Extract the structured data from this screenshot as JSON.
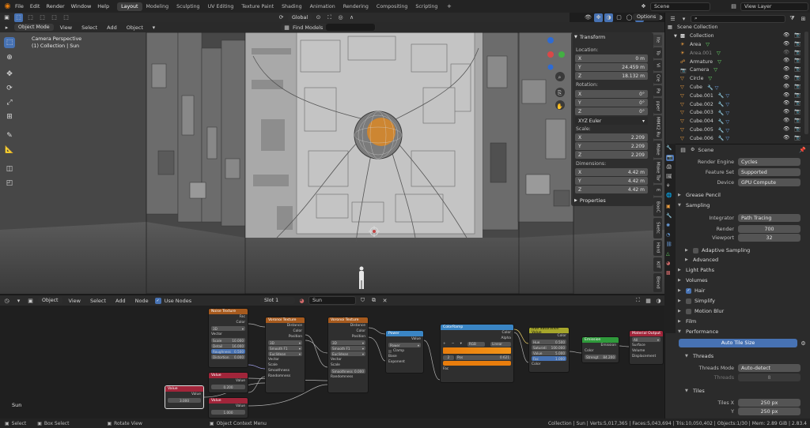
{
  "topbar": {
    "menus": [
      "File",
      "Edit",
      "Render",
      "Window",
      "Help"
    ],
    "workspaces": [
      "Layout",
      "Modeling",
      "Sculpting",
      "UV Editing",
      "Texture Paint",
      "Shading",
      "Animation",
      "Rendering",
      "Compositing",
      "Scripting"
    ],
    "active_workspace": "Layout",
    "scene": "Scene",
    "view_layer": "View Layer"
  },
  "viewport": {
    "mode": "Object Mode",
    "menus": [
      "View",
      "Select",
      "Add",
      "Object"
    ],
    "orientation": "Global",
    "options_label": "Options",
    "info_line1": "Camera Perspective",
    "info_line2": "(1) Collection | Sun",
    "find_models": "Find Models"
  },
  "npanel": {
    "transform_title": "Transform",
    "location_label": "Location:",
    "location": [
      {
        "axis": "X",
        "value": "0 m"
      },
      {
        "axis": "Y",
        "value": "24.459 m"
      },
      {
        "axis": "Z",
        "value": "18.132 m"
      }
    ],
    "rotation_label": "Rotation:",
    "rotation": [
      {
        "axis": "X",
        "value": "0°"
      },
      {
        "axis": "Y",
        "value": "0°"
      },
      {
        "axis": "Z",
        "value": "0°"
      }
    ],
    "rotation_mode": "XYZ Euler",
    "scale_label": "Scale:",
    "scale": [
      {
        "axis": "X",
        "value": "2.209"
      },
      {
        "axis": "Y",
        "value": "2.209"
      },
      {
        "axis": "Z",
        "value": "2.209"
      }
    ],
    "dimensions_label": "Dimensions:",
    "dimensions": [
      {
        "axis": "X",
        "value": "4.42 m"
      },
      {
        "axis": "Y",
        "value": "4.42 m"
      },
      {
        "axis": "Z",
        "value": "4.42 m"
      }
    ],
    "properties_title": "Properties",
    "side_tabs": [
      "Ite",
      "To",
      "Vi",
      "Cre",
      "Pa",
      "pper",
      "MMX2 Ru",
      "Make",
      "Make Tar",
      "E",
      "BooC",
      "Sketc",
      "Hard",
      "KIT",
      "Blend"
    ]
  },
  "outliner": {
    "search_placeholder": "",
    "root": "Scene Collection",
    "collection": "Collection",
    "items": [
      "Area",
      "Area.001",
      "Armature",
      "Camera",
      "Circle",
      "Cube",
      "Cube.001",
      "Cube.002",
      "Cube.003",
      "Cube.004",
      "Cube.005",
      "Cube.006"
    ]
  },
  "properties": {
    "scene_label": "Scene",
    "render_engine_label": "Render Engine",
    "render_engine": "Cycles",
    "feature_set_label": "Feature Set",
    "feature_set": "Supported",
    "device_label": "Device",
    "device": "GPU Compute",
    "grease_pencil": "Grease Pencil",
    "sampling": "Sampling",
    "integrator_label": "Integrator",
    "integrator": "Path Tracing",
    "render_label": "Render",
    "render_samples": "700",
    "viewport_label": "Viewport",
    "viewport_samples": "32",
    "adaptive_sampling": "Adaptive Sampling",
    "advanced": "Advanced",
    "light_paths": "Light Paths",
    "volumes": "Volumes",
    "hair": "Hair",
    "simplify": "Simplify",
    "motion_blur": "Motion Blur",
    "film": "Film",
    "performance": "Performance",
    "auto_tile_size": "Auto Tile Size",
    "threads": "Threads",
    "threads_mode_label": "Threads Mode",
    "threads_mode": "Auto-detect",
    "threads_label": "Threads",
    "threads_value": "8",
    "tiles": "Tiles",
    "tiles_x_label": "Tiles X",
    "tiles_x": "250 px",
    "tiles_y_label": "Y",
    "tiles_y": "250 px"
  },
  "node_editor": {
    "type": "Object",
    "menus": [
      "View",
      "Select",
      "Add",
      "Node"
    ],
    "use_nodes": "Use Nodes",
    "slot": "Slot 1",
    "material": "Sun",
    "frame_label": "Sun",
    "nodes": {
      "noise": {
        "title": "Noise Texture",
        "outputs": [
          "Fac",
          "Color"
        ],
        "dim": "3D",
        "inputs": [
          "Vector"
        ],
        "fields": [
          {
            "k": "Scale",
            "v": "10.000"
          },
          {
            "k": "Detail",
            "v": "16.000"
          },
          {
            "k": "Roughness",
            "v": "0.500"
          },
          {
            "k": "Distortion",
            "v": "0.000"
          }
        ]
      },
      "voronoi1": {
        "title": "Voronoi Texture",
        "outputs": [
          "Distance",
          "Color",
          "Position"
        ],
        "dim": "3D",
        "feature": "Smooth F1",
        "metric": "Euclidean",
        "inputs": [
          "Vector",
          "Scale",
          "Smoothness",
          "Randomness"
        ]
      },
      "voronoi2": {
        "title": "Voronoi Texture",
        "outputs": [
          "Distance",
          "Color",
          "Position"
        ],
        "dim": "3D",
        "feature": "Smooth F1",
        "metric": "Euclidean",
        "inputs": [
          "Vector",
          "Scale",
          "Smoothness",
          "Randomness"
        ],
        "smooth_value": "0.000"
      },
      "power": {
        "title": "Power",
        "output": "Value",
        "op": "Power",
        "clamp": "Clamp",
        "inputs": [
          "Base",
          "Exponent"
        ]
      },
      "colorramp": {
        "title": "ColorRamp",
        "outputs": [
          "Color",
          "Alpha"
        ],
        "mode": "RGB",
        "interp": "Linear",
        "stop": "2",
        "pos_label": "Pos",
        "pos": "0.621",
        "input": "Fac"
      },
      "hsv": {
        "title": "Hue Saturation Value",
        "output": "Color",
        "fields": [
          {
            "k": "Hue",
            "v": "0.500"
          },
          {
            "k": "Saturati",
            "v": "100.000"
          },
          {
            "k": "Value",
            "v": "5.000"
          },
          {
            "k": "Fac",
            "v": "1.000"
          }
        ],
        "input": "Color"
      },
      "emission": {
        "title": "Emission",
        "output": "Emission",
        "inputs": [
          "Color"
        ],
        "strength_label": "Strengt",
        "strength": "84.200"
      },
      "output": {
        "title": "Material Output",
        "target": "All",
        "inputs": [
          "Surface",
          "Volume",
          "Displacement"
        ]
      },
      "value1": {
        "title": "Value",
        "output": "Value",
        "value": "0.200"
      },
      "value2": {
        "title": "Value",
        "output": "Value",
        "value": "3.000"
      },
      "value3": {
        "title": "Value",
        "output": "Value",
        "value": "1.000"
      }
    }
  },
  "statusbar": {
    "left": [
      "Select",
      "Box Select",
      "Rotate View",
      "Object Context Menu"
    ],
    "stats": "Collection | Sun | Verts:5,017,365 | Faces:5,043,694 | Tris:10,050,402 | Objects:1/30 | Mem: 2.89 GiB | 2.83.4"
  },
  "colors": {
    "accent": "#4772b3",
    "orange": "#e87d0d",
    "noise_header": "#a65a1e",
    "value_header": "#a1253a",
    "shader_header": "#2f9a3b",
    "math_header": "#3a85c4"
  }
}
